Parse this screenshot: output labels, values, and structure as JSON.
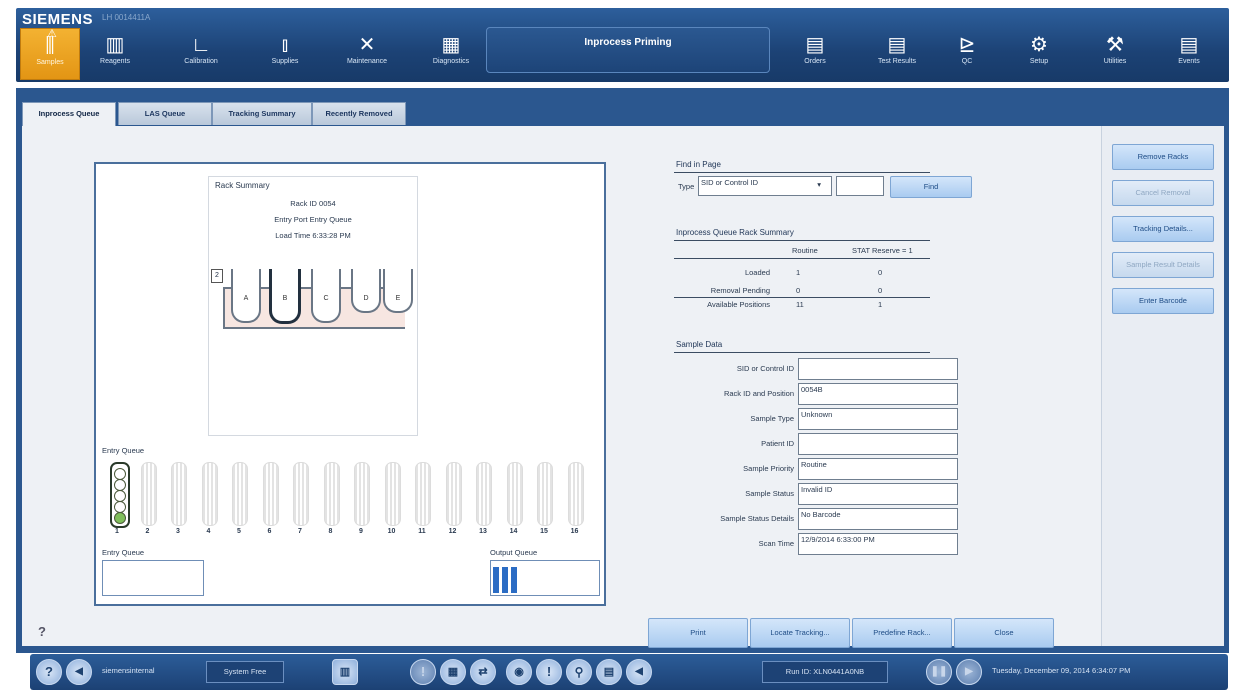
{
  "header": {
    "brand": "SIEMENS",
    "system_id": "LH 0014411A",
    "title": "Inprocess Priming",
    "nav_left": [
      {
        "label": "Samples",
        "icon": "samples-icon",
        "glyph": "⫼",
        "active": true
      },
      {
        "label": "Reagents",
        "icon": "reagents-icon",
        "glyph": "▥"
      },
      {
        "label": "Calibration",
        "icon": "calibration-icon",
        "glyph": "∟"
      },
      {
        "label": "Supplies",
        "icon": "supplies-icon",
        "glyph": "⫾"
      },
      {
        "label": "Maintenance",
        "icon": "maintenance-icon",
        "glyph": "✕"
      },
      {
        "label": "Diagnostics",
        "icon": "diagnostics-icon",
        "glyph": "▦"
      }
    ],
    "nav_right": [
      {
        "label": "Orders",
        "icon": "orders-icon",
        "glyph": "▤"
      },
      {
        "label": "Test Results",
        "icon": "test-results-icon",
        "glyph": "▤"
      },
      {
        "label": "QC",
        "icon": "qc-icon",
        "glyph": "⊵"
      },
      {
        "label": "Setup",
        "icon": "setup-icon",
        "glyph": "⚙"
      },
      {
        "label": "Utilities",
        "icon": "utilities-icon",
        "glyph": "⚒"
      },
      {
        "label": "Events",
        "icon": "events-icon",
        "glyph": "▤"
      }
    ]
  },
  "tabs": [
    "Inprocess Queue",
    "LAS Queue",
    "Tracking Summary",
    "Recently Removed"
  ],
  "active_tab": 0,
  "rack_summary": {
    "title": "Rack Summary",
    "rack_id": "Rack ID  0054",
    "entry_port": "Entry Port  Entry Queue",
    "load_time": "Load Time  6:33:28 PM",
    "positions": [
      "A",
      "B",
      "C",
      "D",
      "E"
    ],
    "rack_marker": "2"
  },
  "entry_queue": {
    "label": "Entry Queue",
    "slots": [
      "1",
      "2",
      "3",
      "4",
      "5",
      "6",
      "7",
      "8",
      "9",
      "10",
      "11",
      "12",
      "13",
      "14",
      "15",
      "16"
    ]
  },
  "entry_queue_bottom_label": "Entry Queue",
  "output_queue_label": "Output Queue",
  "find": {
    "section_label": "Find in Page",
    "type_label": "Type",
    "type_value": "SID or Control ID",
    "search_value": "",
    "button": "Find"
  },
  "queue_summary": {
    "title": "Inprocess Queue Rack Summary",
    "col_routine": "Routine",
    "col_stat": "STAT Reserve = 1",
    "rows": [
      {
        "label": "Loaded",
        "routine": "1",
        "stat": "0"
      },
      {
        "label": "Removal Pending",
        "routine": "0",
        "stat": "0"
      },
      {
        "label": "Available Positions",
        "routine": "11",
        "stat": "1"
      }
    ]
  },
  "sample_data": {
    "title": "Sample Data",
    "fields": [
      {
        "label": "SID or Control ID",
        "value": ""
      },
      {
        "label": "Rack ID and Position",
        "value": "0054B"
      },
      {
        "label": "Sample Type",
        "value": "Unknown"
      },
      {
        "label": "Patient ID",
        "value": ""
      },
      {
        "label": "Sample Priority",
        "value": "Routine"
      },
      {
        "label": "Sample Status",
        "value": "Invalid ID"
      },
      {
        "label": "Sample Status Details",
        "value": "No Barcode"
      },
      {
        "label": "Scan Time",
        "value": "12/9/2014 6:33:00 PM"
      }
    ]
  },
  "side_buttons": [
    {
      "label": "Remove Racks",
      "enabled": true
    },
    {
      "label": "Cancel Removal",
      "enabled": false
    },
    {
      "label": "Tracking Details...",
      "enabled": true
    },
    {
      "label": "Sample Result Details",
      "enabled": false
    },
    {
      "label": "Enter Barcode",
      "enabled": true
    }
  ],
  "bottom_buttons": [
    "Print",
    "Locate Tracking...",
    "Predefine Rack...",
    "Close"
  ],
  "help_mark": "?",
  "statusbar": {
    "user": "siemensinternal",
    "system_state": "System Free",
    "run_id": "Run ID: XLN0441A0NB",
    "datetime": "Tuesday, December 09, 2014 6:34:07 PM",
    "help_glyph": "?"
  }
}
